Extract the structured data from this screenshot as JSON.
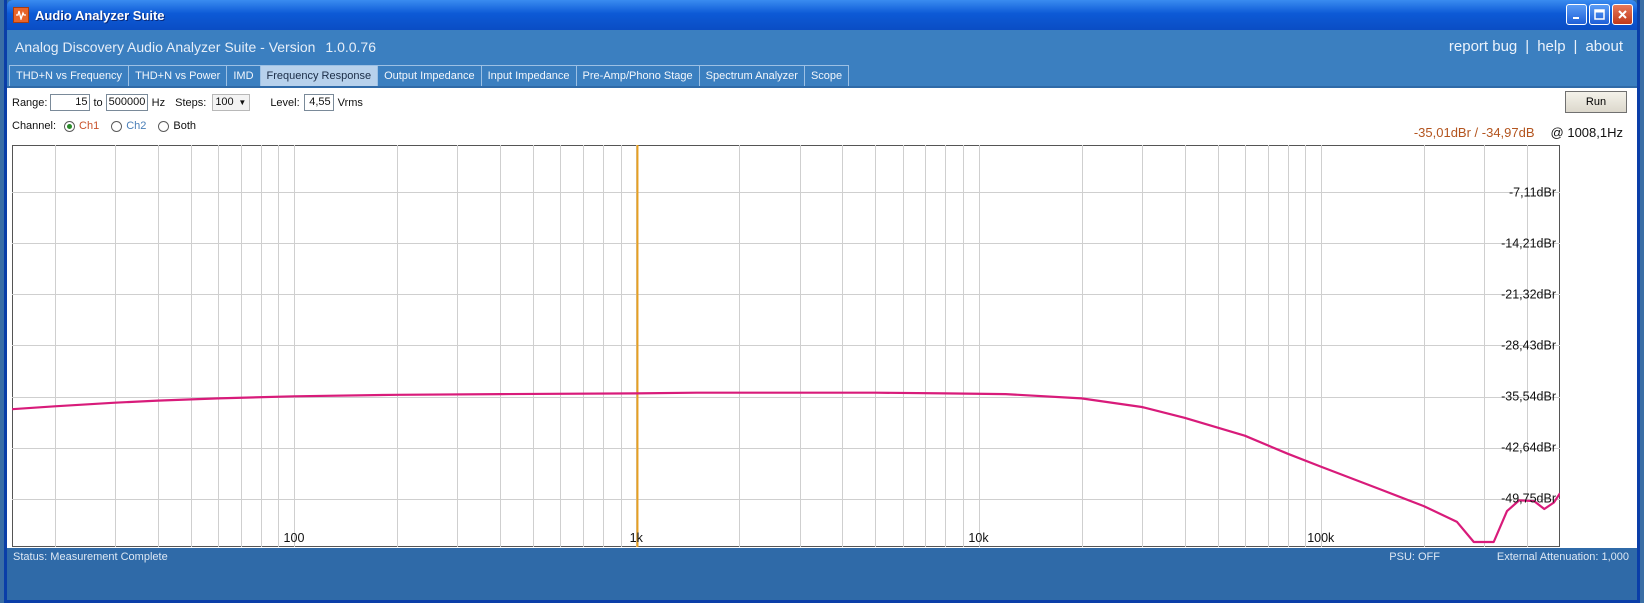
{
  "window": {
    "title": "Audio Analyzer Suite"
  },
  "header": {
    "app_name": "Analog Discovery Audio Analyzer Suite - Version",
    "version": "1.0.0.76",
    "links": [
      "report bug",
      "help",
      "about"
    ]
  },
  "tabs": [
    {
      "label": "THD+N vs Frequency",
      "active": false
    },
    {
      "label": "THD+N vs Power",
      "active": false
    },
    {
      "label": "IMD",
      "active": false
    },
    {
      "label": "Frequency Response",
      "active": true
    },
    {
      "label": "Output Impedance",
      "active": false
    },
    {
      "label": "Input Impedance",
      "active": false
    },
    {
      "label": "Pre-Amp/Phono Stage",
      "active": false
    },
    {
      "label": "Spectrum Analyzer",
      "active": false
    },
    {
      "label": "Scope",
      "active": false
    }
  ],
  "controls": {
    "range_label": "Range:",
    "range_from": "15",
    "to_label": "to",
    "range_to": "500000",
    "hz_label": "Hz",
    "steps_label": "Steps:",
    "steps_value": "100",
    "level_label": "Level:",
    "level_value": "4,55",
    "level_unit": "Vrms",
    "channel_label": "Channel:",
    "channels": [
      {
        "label": "Ch1",
        "selected": true,
        "color": "#c8502a"
      },
      {
        "label": "Ch2",
        "selected": false,
        "color": "#4a7fb8"
      },
      {
        "label": "Both",
        "selected": false,
        "color": "#111111"
      }
    ],
    "run_label": "Run"
  },
  "readout": {
    "values": "-35,01dBr / -34,97dB",
    "frequency": "@ 1008,1Hz"
  },
  "chart_data": {
    "type": "line",
    "x_scale": "log",
    "xlim": [
      15,
      500000
    ],
    "ylim": [
      -56.5,
      -0.5
    ],
    "x_ticks": [
      {
        "value": 100,
        "label": "100"
      },
      {
        "value": 1000,
        "label": "1k"
      },
      {
        "value": 10000,
        "label": "10k"
      },
      {
        "value": 100000,
        "label": "100k"
      }
    ],
    "y_ticks": [
      {
        "value": -7.11,
        "label": "-7,11dBr"
      },
      {
        "value": -14.21,
        "label": "-14,21dBr"
      },
      {
        "value": -21.32,
        "label": "-21,32dBr"
      },
      {
        "value": -28.43,
        "label": "-28,43dBr"
      },
      {
        "value": -35.54,
        "label": "-35,54dBr"
      },
      {
        "value": -42.64,
        "label": "-42,64dBr"
      },
      {
        "value": -49.75,
        "label": "-49,75dBr"
      }
    ],
    "grid": true,
    "cursor": {
      "x": 1008.1,
      "color": "#e8a020"
    },
    "series": [
      {
        "color": "#d81b7a",
        "points": [
          [
            15,
            -37.3
          ],
          [
            20,
            -36.9
          ],
          [
            30,
            -36.4
          ],
          [
            40,
            -36.1
          ],
          [
            60,
            -35.8
          ],
          [
            100,
            -35.5
          ],
          [
            200,
            -35.3
          ],
          [
            400,
            -35.2
          ],
          [
            1000,
            -35.1
          ],
          [
            1500,
            -35.0
          ],
          [
            3000,
            -35.0
          ],
          [
            5000,
            -35.0
          ],
          [
            8000,
            -35.1
          ],
          [
            12000,
            -35.2
          ],
          [
            20000,
            -35.8
          ],
          [
            30000,
            -37.0
          ],
          [
            40000,
            -38.5
          ],
          [
            60000,
            -41.0
          ],
          [
            80000,
            -43.5
          ],
          [
            100000,
            -45.3
          ],
          [
            150000,
            -48.5
          ],
          [
            200000,
            -50.8
          ],
          [
            250000,
            -53.0
          ],
          [
            280000,
            -55.8
          ],
          [
            320000,
            -55.8
          ],
          [
            350000,
            -51.5
          ],
          [
            380000,
            -50.0
          ],
          [
            420000,
            -50.1
          ],
          [
            450000,
            -51.2
          ],
          [
            480000,
            -50.3
          ],
          [
            500000,
            -49.0
          ]
        ]
      }
    ]
  },
  "status": {
    "text": "Status: Measurement Complete",
    "psu": "PSU: OFF",
    "attenuation": "External Attenuation: 1,000"
  },
  "icons": {
    "app": "waveform-icon",
    "minimize": "minimize-icon",
    "maximize": "maximize-icon",
    "close": "close-icon"
  }
}
